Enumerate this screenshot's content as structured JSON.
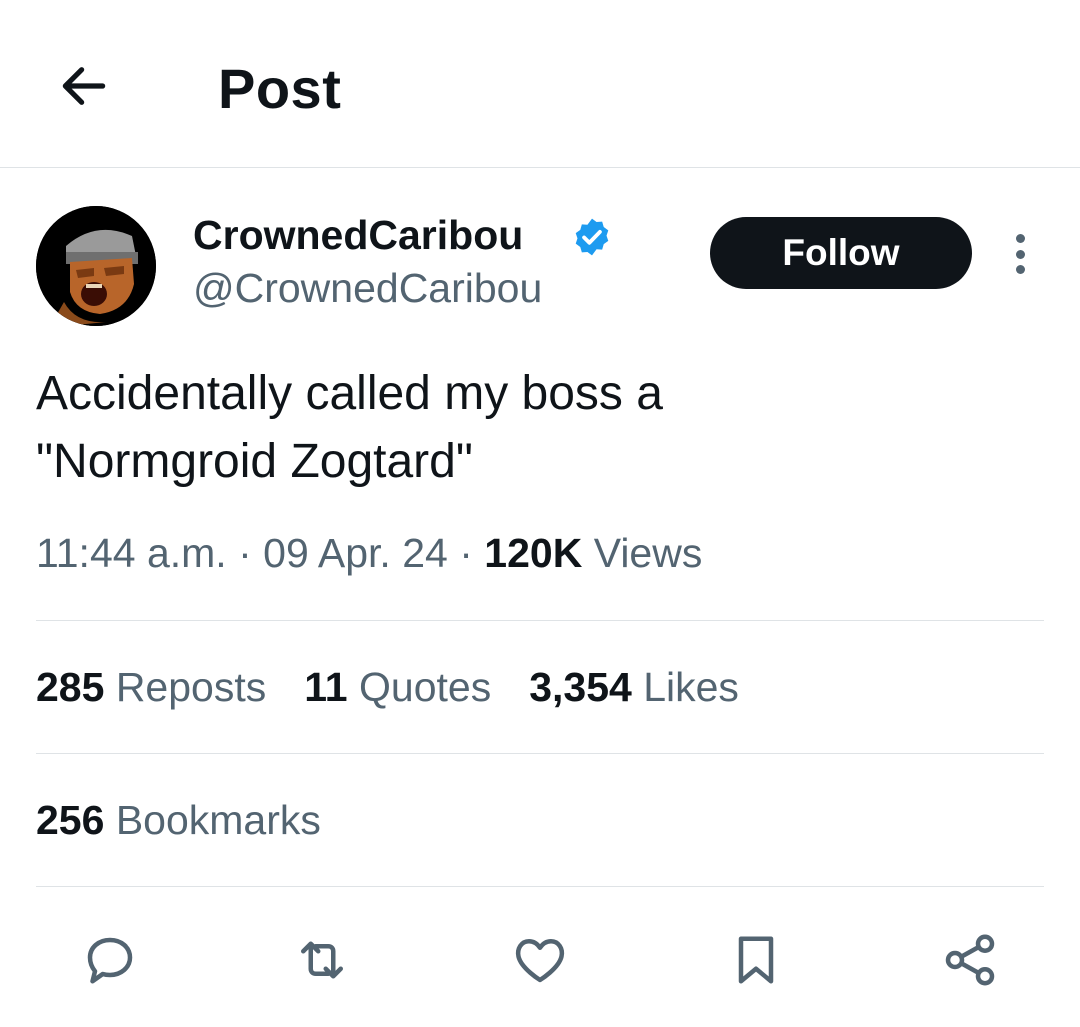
{
  "header": {
    "title": "Post",
    "back_icon": "arrow-left-icon"
  },
  "author": {
    "display_name": "CrownedCaribou",
    "handle": "@CrownedCaribou",
    "verified": true,
    "verified_color": "#1d9bf0",
    "avatar_icon": "avatar-pixel-art-character"
  },
  "follow_button": {
    "label": "Follow"
  },
  "post": {
    "text": "Accidentally called my boss a\n\"Normgroid Zogtard\""
  },
  "meta": {
    "time": "11:44 a.m.",
    "separator": "·",
    "date": "09 Apr. 24",
    "views_count": "120K",
    "views_label": "Views"
  },
  "stats": {
    "reposts": {
      "count": "285",
      "label": "Reposts"
    },
    "quotes": {
      "count": "11",
      "label": "Quotes"
    },
    "likes": {
      "count": "3,354",
      "label": "Likes"
    },
    "bookmarks": {
      "count": "256",
      "label": "Bookmarks"
    }
  },
  "actions": [
    "reply-icon",
    "repost-icon",
    "like-icon",
    "bookmark-icon",
    "share-icon"
  ],
  "colors": {
    "text_primary": "#0f1419",
    "text_secondary": "#536471",
    "divider": "#dfe3e6",
    "follow_bg": "#0f1419"
  }
}
